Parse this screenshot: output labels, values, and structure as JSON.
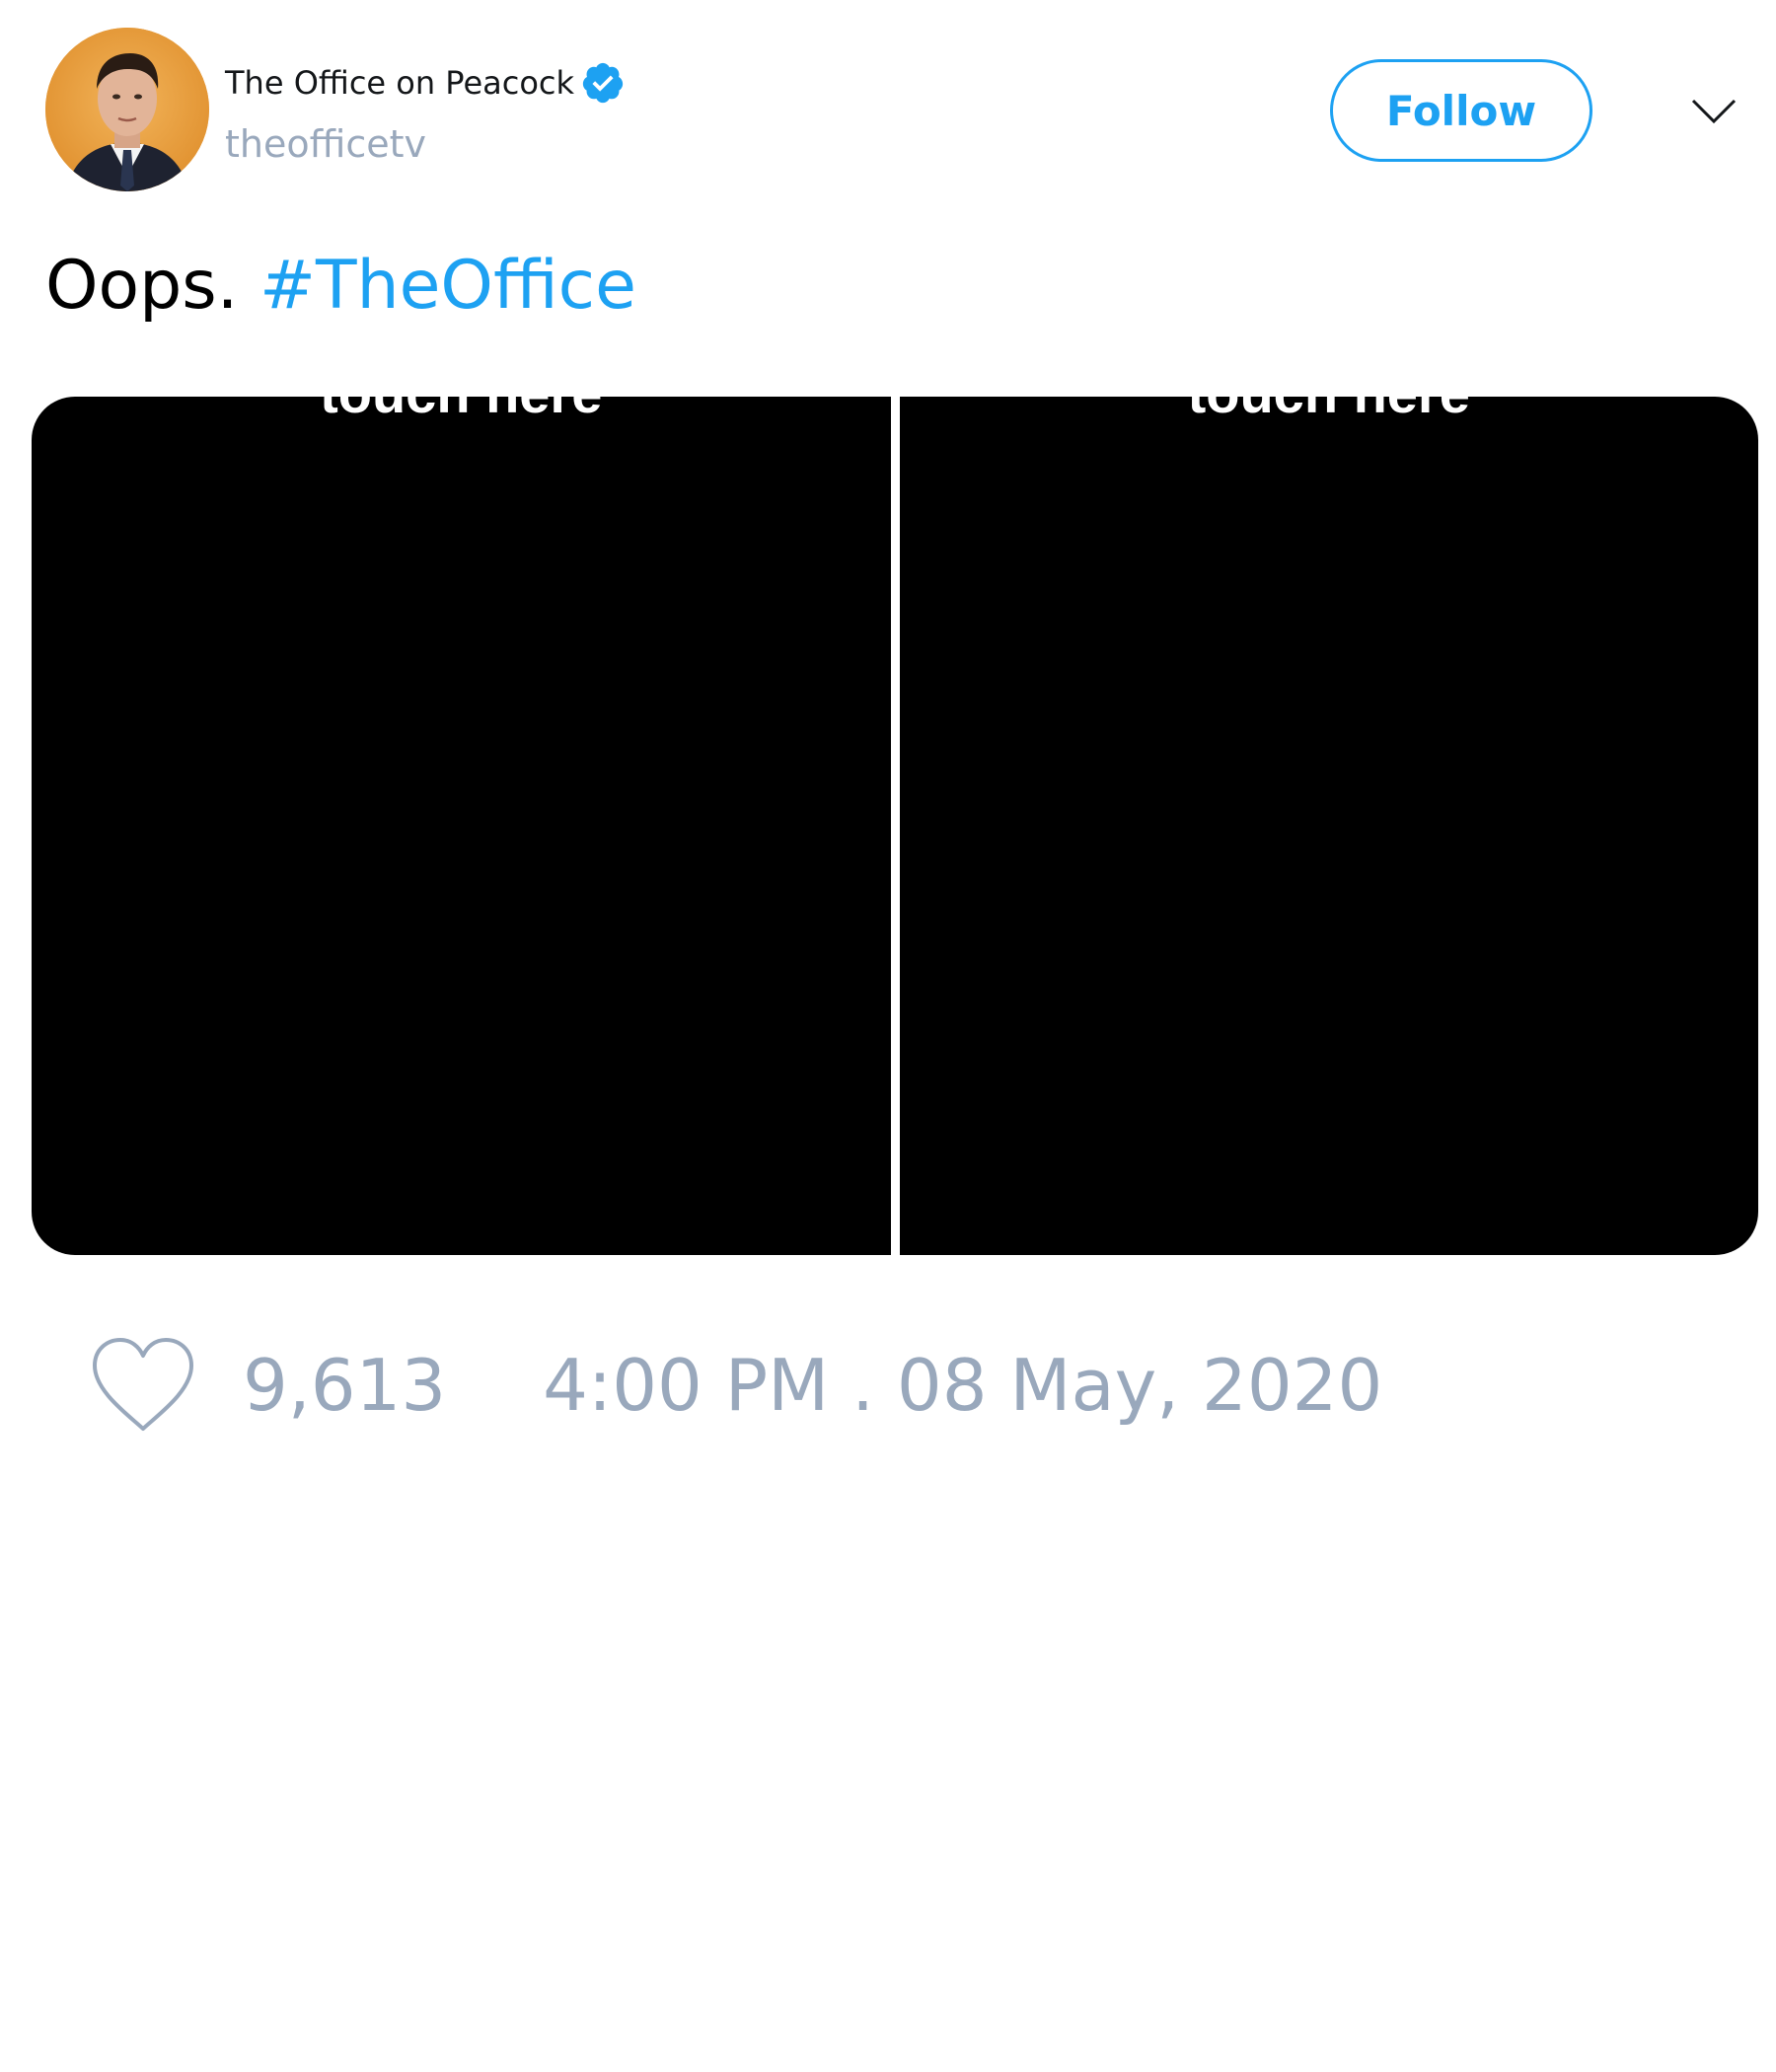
{
  "user": {
    "display_name": "The Office on Peacock",
    "handle": "theofficetv",
    "verified": true,
    "avatar_icon": "profile-photo"
  },
  "header": {
    "follow_label": "Follow",
    "menu_icon": "chevron-down-icon"
  },
  "tweet": {
    "text": "Oops.",
    "hashtag": "#TheOffice",
    "media": [
      {
        "caption": "touch here"
      },
      {
        "caption": "touch here"
      }
    ]
  },
  "footer": {
    "like_icon": "heart-icon",
    "like_count": "9,613",
    "timestamp": "4:00 PM . 08 May, 2020"
  },
  "colors": {
    "accent": "#1da1f2",
    "muted": "#99a8bc",
    "text": "#14171a",
    "media_background": "#000000"
  }
}
